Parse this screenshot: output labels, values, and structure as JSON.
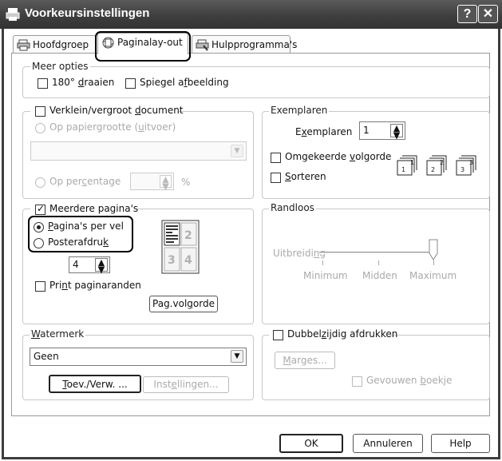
{
  "window": {
    "title": "Voorkeursinstellingen",
    "help_glyph": "?",
    "close_glyph": "✕"
  },
  "tabs": [
    {
      "label": "Hoofdgroep",
      "icon": "printer-icon"
    },
    {
      "label": "Paginalay-out",
      "icon": "layout-icon",
      "active": true
    },
    {
      "label": "Hulpprogramma's",
      "icon": "tools-icon"
    }
  ],
  "meer_opties": {
    "label": "Meer opties",
    "rotate": {
      "label_pre": "180° ",
      "label_ul": "d",
      "label_post": "raaien",
      "checked": false
    },
    "mirror": {
      "label_pre": "Spiegel a",
      "label_ul": "f",
      "label_post": "beelding",
      "checked": false
    }
  },
  "verklein": {
    "label_pre": "Verklein/vergroot ",
    "label_ul": "d",
    "label_post": "ocument",
    "checked": false,
    "paper_option": {
      "label_pre": "Op papiergrootte (",
      "label_ul": "u",
      "label_post": "itvoer)"
    },
    "paper_select_value": "",
    "percentage_option": {
      "label_pre": "Op per",
      "label_ul": "c",
      "label_post": "entage"
    },
    "percentage_value": "",
    "percentage_unit": "%"
  },
  "exemplaren": {
    "label": "Exemplaren",
    "count_label_pre": "E",
    "count_label_ul": "x",
    "count_label_post": "emplaren",
    "count_value": "1",
    "reverse": {
      "label_pre": "Omgekeerde ",
      "label_ul": "v",
      "label_post": "olgorde",
      "checked": false
    },
    "collate": {
      "label_ul": "S",
      "label_post": "orteren",
      "checked": false
    },
    "copy_icons": [
      "1",
      "2",
      "3"
    ]
  },
  "meerdere": {
    "label": "Meerdere pagina's",
    "checked": true,
    "pages_per_sheet": {
      "label_ul": "P",
      "label_post": "agina's per vel",
      "checked": true
    },
    "poster": {
      "label_pre": "Posterafdru",
      "label_ul": "k",
      "label_post": "",
      "checked": false
    },
    "pages_value": "4",
    "print_borders": {
      "label_pre": "Pri",
      "label_ul": "n",
      "label_post": "t paginaranden",
      "checked": false
    },
    "preview_numbers": [
      "2",
      "3",
      "4"
    ],
    "order_button": {
      "label_pre": "Pag.vol",
      "label_ul": "g",
      "label_post": "orde"
    }
  },
  "randloos": {
    "label": "Randloos",
    "slider_label_pre": "Uitbreidi",
    "slider_label_ul": "n",
    "slider_label_post": "g",
    "ticks": [
      "Minimum",
      "Midden",
      "Maximum"
    ],
    "level": "Maximum"
  },
  "watermerk": {
    "label_ul": "W",
    "label_post": "atermerk",
    "selected": "Geen",
    "edit_button": {
      "label_ul": "T",
      "label_post": "oev./Verw. ..."
    },
    "settings_button": {
      "label_pre": "Inst",
      "label_ul": "e",
      "label_post": "llingen..."
    }
  },
  "duplex": {
    "label_pre": "Dubbel",
    "label_ul": "z",
    "label_post": "ijdig afdrukken",
    "checked": false,
    "margins_button": {
      "label_ul": "M",
      "label_post": "arges..."
    },
    "booklet": {
      "label_pre": "Gevouwen ",
      "label_ul": "b",
      "label_post": "oekje",
      "checked": false
    }
  },
  "footer": {
    "ok": "OK",
    "cancel": "Annuleren",
    "help": "Help"
  }
}
